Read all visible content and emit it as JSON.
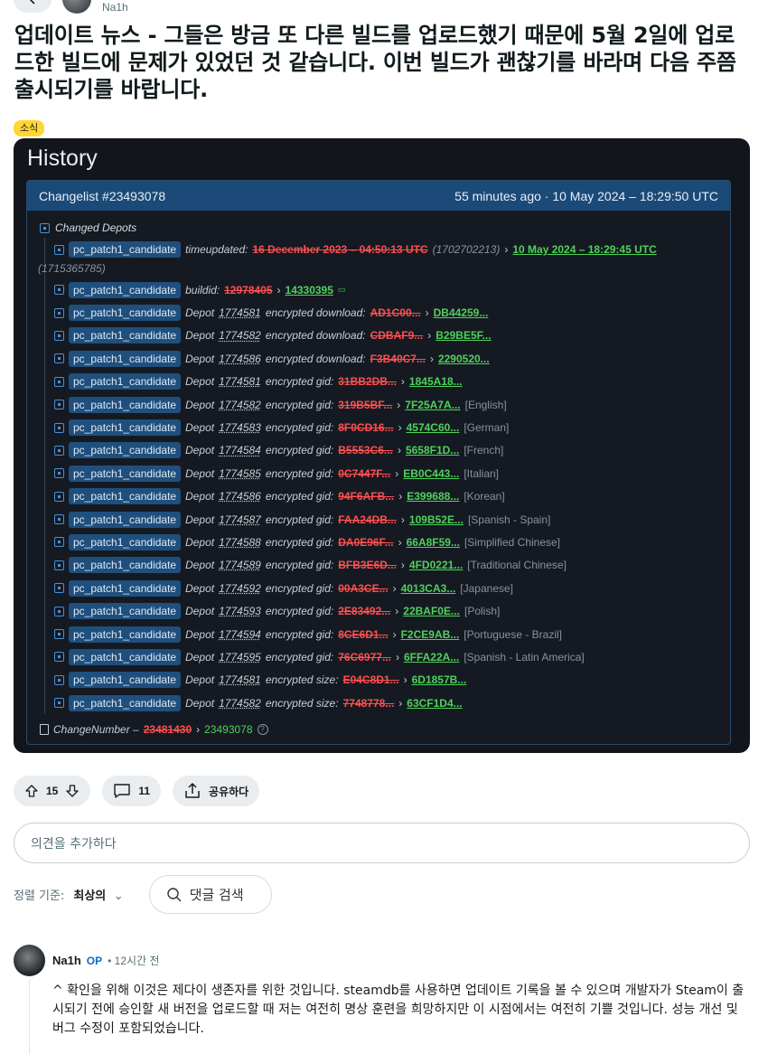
{
  "top": {
    "author": "Na1h"
  },
  "post": {
    "title": "업데이트 뉴스 - 그들은 방금 또 다른 빌드를 업로드했기 때문에 5월 2일에 업로드한 빌드에 문제가 있었던 것 같습니다. 이번 빌드가 괜찮기를 바라며 다음 주쯤 출시되기를 바랍니다.",
    "flair": "소식"
  },
  "history": {
    "title": "History",
    "changelist": "Changelist #23493078",
    "time": "55 minutes ago · 10 May 2024 – 18:29:50 UTC",
    "changed_depots": "Changed Depots",
    "tag": "pc_patch1_candidate",
    "timeupdated": {
      "label": "timeupdated:",
      "old": "16 December 2023 – 04:50:13 UTC",
      "old_raw": "(1702702213)",
      "new": "10 May 2024 – 18:29:45 UTC",
      "new_raw": "(1715365785)"
    },
    "buildid": {
      "label": "buildid:",
      "old": "12978405",
      "new": "14330395"
    },
    "depot_word": "Depot",
    "rows": [
      {
        "depot": "1774581",
        "field": "encrypted download:",
        "old": "AD1C00...",
        "new": "DB44259...",
        "lang": ""
      },
      {
        "depot": "1774582",
        "field": "encrypted download:",
        "old": "CDBAF9...",
        "new": "B29BE5F...",
        "lang": ""
      },
      {
        "depot": "1774586",
        "field": "encrypted download:",
        "old": "F3B40C7...",
        "new": "2290520...",
        "lang": ""
      },
      {
        "depot": "1774581",
        "field": "encrypted gid:",
        "old": "31BB2DB...",
        "new": "1845A18...",
        "lang": ""
      },
      {
        "depot": "1774582",
        "field": "encrypted gid:",
        "old": "319B5BF...",
        "new": "7F25A7A...",
        "lang": "[English]"
      },
      {
        "depot": "1774583",
        "field": "encrypted gid:",
        "old": "8F0CD16...",
        "new": "4574C60...",
        "lang": "[German]"
      },
      {
        "depot": "1774584",
        "field": "encrypted gid:",
        "old": "B5553C6...",
        "new": "5658F1D...",
        "lang": "[French]"
      },
      {
        "depot": "1774585",
        "field": "encrypted gid:",
        "old": "0C7447F...",
        "new": "EB0C443...",
        "lang": "[Italian]"
      },
      {
        "depot": "1774586",
        "field": "encrypted gid:",
        "old": "94F6AFB...",
        "new": "E399688...",
        "lang": "[Korean]"
      },
      {
        "depot": "1774587",
        "field": "encrypted gid:",
        "old": "FAA24DB...",
        "new": "109B52E...",
        "lang": "[Spanish - Spain]"
      },
      {
        "depot": "1774588",
        "field": "encrypted gid:",
        "old": "DA0E96F...",
        "new": "66A8F59...",
        "lang": "[Simplified Chinese]"
      },
      {
        "depot": "1774589",
        "field": "encrypted gid:",
        "old": "BFB3E6D...",
        "new": "4FD0221...",
        "lang": "[Traditional Chinese]"
      },
      {
        "depot": "1774592",
        "field": "encrypted gid:",
        "old": "00A3CE...",
        "new": "4013CA3...",
        "lang": "[Japanese]"
      },
      {
        "depot": "1774593",
        "field": "encrypted gid:",
        "old": "2E83492...",
        "new": "22BAF0E...",
        "lang": "[Polish]"
      },
      {
        "depot": "1774594",
        "field": "encrypted gid:",
        "old": "8CE6D1...",
        "new": "F2CE9AB...",
        "lang": "[Portuguese - Brazil]"
      },
      {
        "depot": "1774595",
        "field": "encrypted gid:",
        "old": "76C6977...",
        "new": "6FFA22A...",
        "lang": "[Spanish - Latin America]"
      },
      {
        "depot": "1774581",
        "field": "encrypted size:",
        "old": "E04C8D1...",
        "new": "6D1857B...",
        "lang": ""
      },
      {
        "depot": "1774582",
        "field": "encrypted size:",
        "old": "7748778...",
        "new": "63CF1D4...",
        "lang": ""
      }
    ],
    "changenumber": {
      "label": "ChangeNumber –",
      "old": "23481430",
      "new": "23493078"
    }
  },
  "actions": {
    "votes": "15",
    "comments": "11",
    "share": "공유하다"
  },
  "comment_input": {
    "placeholder": "의견을 추가하다"
  },
  "sort": {
    "label": "정렬 기준:",
    "value": "최상의",
    "search": "댓글 검색"
  },
  "comment": {
    "author": "Na1h",
    "op": "OP",
    "time": "• 12시간 전",
    "body": "^ 확인을 위해 이것은 제다이 생존자를 위한 것입니다. steamdb를 사용하면 업데이트 기록을 볼 수 있으며 개발자가 Steam이 출시되기 전에 승인할 새 버전을 업로드할 때 저는 여전히 명상 훈련을 희망하지만 이 시점에서는 여전히 기쁠 것입니다. 성능 개선 및 버그 수정이 포함되었습니다."
  }
}
